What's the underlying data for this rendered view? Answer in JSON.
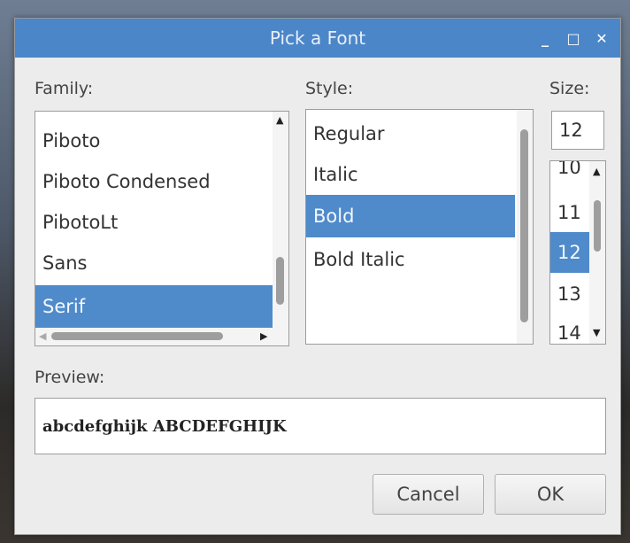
{
  "window": {
    "title": "Pick a Font",
    "controls": {
      "minimize": "_",
      "maximize": "□",
      "close": "✕"
    }
  },
  "labels": {
    "family": "Family:",
    "style": "Style:",
    "size": "Size:",
    "preview": "Preview:"
  },
  "family": {
    "items": [
      "Piboto",
      "Piboto Condensed",
      "PibotoLt",
      "Sans",
      "Serif"
    ],
    "selected": "Serif"
  },
  "style": {
    "items": [
      "Regular",
      "Italic",
      "Bold",
      "Bold Italic"
    ],
    "selected": "Bold"
  },
  "size": {
    "value": "12",
    "items": [
      "10",
      "11",
      "12",
      "13",
      "14"
    ],
    "selected": "12"
  },
  "preview": {
    "text": "abcdefghijk ABCDEFGHIJK"
  },
  "buttons": {
    "cancel": "Cancel",
    "ok": "OK"
  },
  "colors": {
    "titlebar": "#4b86c8",
    "selection": "#4f8acb",
    "dialog_bg": "#ececec"
  }
}
